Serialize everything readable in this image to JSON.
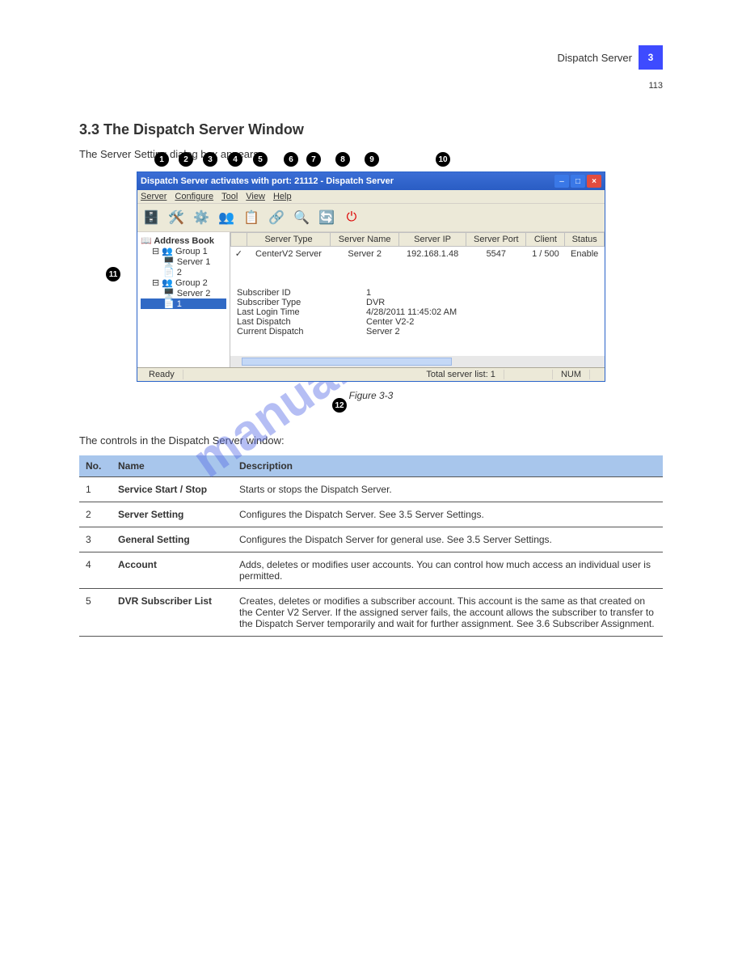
{
  "page": {
    "marker": "3",
    "chapter": "Dispatch Server",
    "number": "113",
    "section_title": "3.3  The Dispatch Server Window",
    "intro": "The Server Setting dialog box appears.",
    "figure_caption": "Figure 3-3",
    "body_text": "The controls in the Dispatch Server window:",
    "watermark": "manualshive.com"
  },
  "window": {
    "title": "Dispatch Server activates with port: 21112 - Dispatch Server",
    "menus": [
      "Server",
      "Configure",
      "Tool",
      "View",
      "Help"
    ],
    "tree_root": "Address Book",
    "tree": [
      {
        "label": "Group 1",
        "children": [
          "Server 1",
          "2"
        ]
      },
      {
        "label": "Group 2",
        "children": [
          "Server 2",
          "1"
        ]
      }
    ],
    "grid_headers": [
      "",
      "Server Type",
      "Server Name",
      "Server IP",
      "Server Port",
      "Client",
      "Status"
    ],
    "grid_row": [
      "✓",
      "CenterV2 Server",
      "Server 2",
      "192.168.1.48",
      "5547",
      "1 / 500",
      "Enable"
    ],
    "details": [
      [
        "Subscriber ID",
        "1"
      ],
      [
        "Subscriber Type",
        "DVR"
      ],
      [
        "Last Login Time",
        "4/28/2011 11:45:02 AM"
      ],
      [
        "Last Dispatch",
        "Center V2-2"
      ],
      [
        "Current Dispatch",
        "Server 2"
      ]
    ],
    "status_ready": "Ready",
    "status_total": "Total server list: 1",
    "status_num": "NUM"
  },
  "callouts": {
    "1": "1",
    "2": "2",
    "3": "3",
    "4": "4",
    "5": "5",
    "6": "6",
    "7": "7",
    "8": "8",
    "9": "9",
    "10": "10",
    "11": "11",
    "12": "12"
  },
  "table": {
    "headers": [
      "No.",
      "Name",
      "Description"
    ],
    "rows": [
      {
        "no": "1",
        "name": "Service Start / Stop",
        "desc": "Starts or stops the Dispatch Server."
      },
      {
        "no": "2",
        "name": "Server Setting",
        "desc": "Configures the Dispatch Server. See 3.5 Server Settings."
      },
      {
        "no": "3",
        "name": "General Setting",
        "desc": "Configures the Dispatch Server for general use. See 3.5 Server Settings."
      },
      {
        "no": "4",
        "name": "Account",
        "desc": "Adds, deletes or modifies user accounts. You can control how much access an individual user is permitted."
      },
      {
        "no": "5",
        "name": "DVR Subscriber List",
        "desc": "Creates, deletes or modifies a subscriber account. This account is the same as that created on the Center V2 Server. If the assigned server fails, the account allows the subscriber to transfer to the Dispatch Server temporarily and wait for further assignment. See 3.6 Subscriber Assignment."
      }
    ]
  }
}
